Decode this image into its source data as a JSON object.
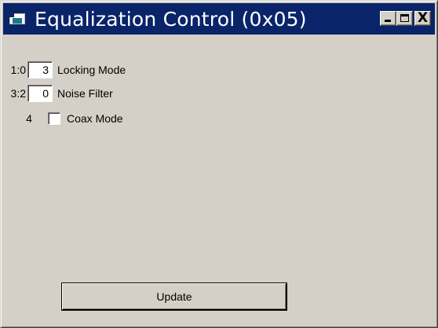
{
  "window": {
    "title": "Equalization Control (0x05)",
    "title_bar_color": "#0a246a",
    "icon": "app-window-icon",
    "caption_buttons": {
      "minimize": "_",
      "maximize": "□",
      "close": "X"
    }
  },
  "fields": [
    {
      "bits": "1:0",
      "value": "3",
      "label": "Locking Mode"
    },
    {
      "bits": "3:2",
      "value": "0",
      "label": "Noise Filter"
    }
  ],
  "checkbox": {
    "bits": "4",
    "label": "Coax Mode",
    "checked": false
  },
  "update_button": {
    "label": "Update"
  }
}
